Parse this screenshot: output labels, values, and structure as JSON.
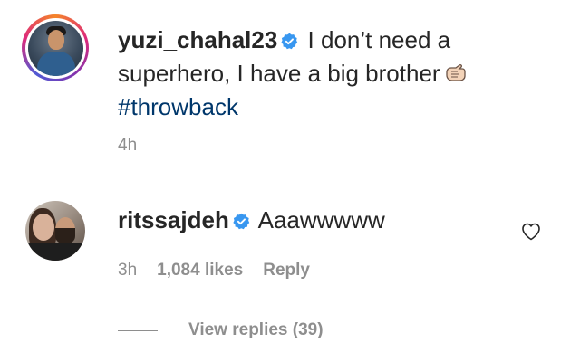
{
  "caption": {
    "username": "yuzi_chahal23",
    "verified_icon": "verified-badge-icon",
    "text": "I don’t need a superhero, I have a big brother",
    "emoji_icon": "fist-bump-emoji-icon",
    "hashtag": "#throwback",
    "time": "4h"
  },
  "comment": {
    "username": "ritssajdeh",
    "verified_icon": "verified-badge-icon",
    "text": "Aaawwwww",
    "time": "3h",
    "likes": "1,084 likes",
    "reply_label": "Reply",
    "like_icon": "heart-outline-icon"
  },
  "replies": {
    "label": "View replies (39)"
  },
  "colors": {
    "text": "#262626",
    "muted": "#8e8e8e",
    "hashtag": "#00376b",
    "verified": "#3897f0"
  }
}
